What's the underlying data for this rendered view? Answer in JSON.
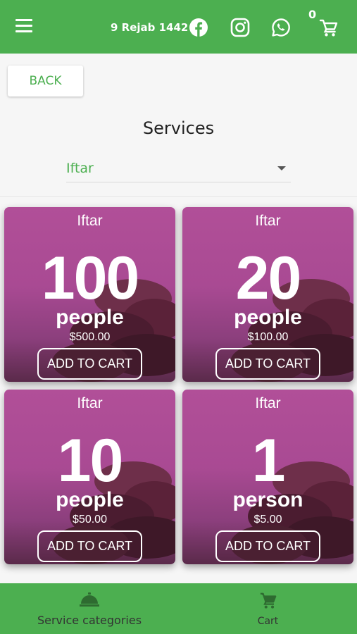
{
  "header": {
    "date": "9 Rejab 1442",
    "cart_count": "0",
    "icons": [
      "menu-icon",
      "facebook-icon",
      "instagram-icon",
      "whatsapp-icon",
      "cart-icon"
    ],
    "bar_color": "#4caf50"
  },
  "back_label": "BACK",
  "page_title": "Services",
  "category_select": {
    "value": "Iftar"
  },
  "cards": [
    {
      "label": "Iftar",
      "number": "100",
      "unit": "people",
      "price": "$500.00",
      "button": "ADD TO CART"
    },
    {
      "label": "Iftar",
      "number": "20",
      "unit": "people",
      "price": "$100.00",
      "button": "ADD TO CART"
    },
    {
      "label": "Iftar",
      "number": "10",
      "unit": "people",
      "price": "$50.00",
      "button": "ADD TO CART"
    },
    {
      "label": "Iftar",
      "number": "1",
      "unit": "person",
      "price": "$5.00",
      "button": "ADD TO CART"
    }
  ],
  "bottom_nav": {
    "items": [
      {
        "label": "Service categories",
        "icon": "service-bell-icon"
      },
      {
        "label": "Cart",
        "icon": "cart-icon"
      }
    ]
  },
  "colors": {
    "accent": "#4caf50",
    "card_bg": "#a94a93"
  }
}
